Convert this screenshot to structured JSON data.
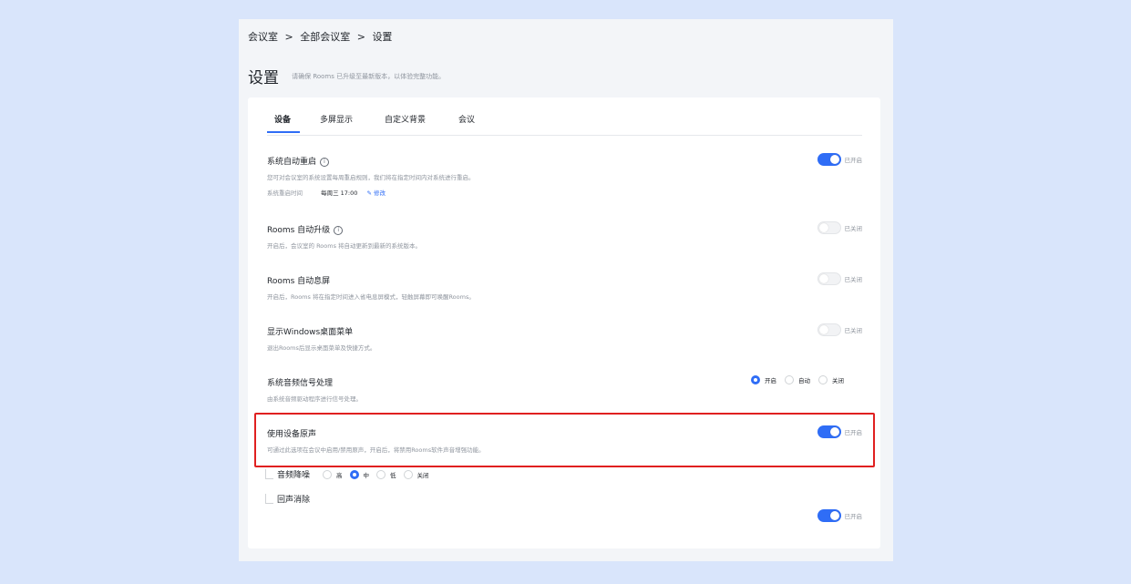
{
  "breadcrumb": [
    "会议室",
    ">",
    "全部会议室",
    ">",
    "设置"
  ],
  "page": {
    "title": "设置",
    "hint": "请确保 Rooms 已升级至最新版本，以体验完整功能。"
  },
  "tabs": [
    "设备",
    "多屏显示",
    "自定义背景",
    "会议"
  ],
  "settings": {
    "auto_restart": {
      "title": "系统自动重启",
      "desc": "您可对会议室的系统设置每周重启规则，我们将在指定时间内对系统进行重启。",
      "meta_label": "系统重启时间",
      "meta_value": "每周三 17:00",
      "edit_label": "修改",
      "state": "已开启",
      "on": true
    },
    "auto_upgrade": {
      "title": "Rooms 自动升级",
      "desc": "开启后，会议室的 Rooms 将自动更新到最新的系统版本。",
      "state": "已关闭",
      "on": false
    },
    "auto_screen_off": {
      "title": "Rooms 自动息屏",
      "desc": "开启后，Rooms 将在指定时间进入省电息屏模式，轻触屏幕即可唤醒Rooms。",
      "state": "已关闭",
      "on": false
    },
    "windows_menu": {
      "title": "显示Windows桌面菜单",
      "desc": "退出Rooms后显示桌面菜单及快捷方式。",
      "state": "已关闭",
      "on": false
    },
    "audio_processing": {
      "title": "系统音频信号处理",
      "desc": "由系统音频驱动程序进行信号处理。",
      "options": [
        "开启",
        "自动",
        "关闭"
      ],
      "selected": "开启"
    },
    "original_sound": {
      "title": "使用设备原声",
      "desc": "可通过此选项在会议中启用/禁用原声，开启后，将禁用Rooms软件声音增强功能。",
      "state": "已开启",
      "on": true
    },
    "noise_reduction": {
      "title": "音频降噪",
      "options": [
        "高",
        "中",
        "低",
        "关闭"
      ],
      "selected": "中"
    },
    "echo_cancel": {
      "title": "回声消除",
      "state": "已开启",
      "on": true
    }
  },
  "colors": {
    "accent": "#2f6df6",
    "highlight": "#e02020",
    "background": "#d9e5fb"
  },
  "icons": {
    "info": "info-circle-icon",
    "edit": "pencil-icon"
  }
}
